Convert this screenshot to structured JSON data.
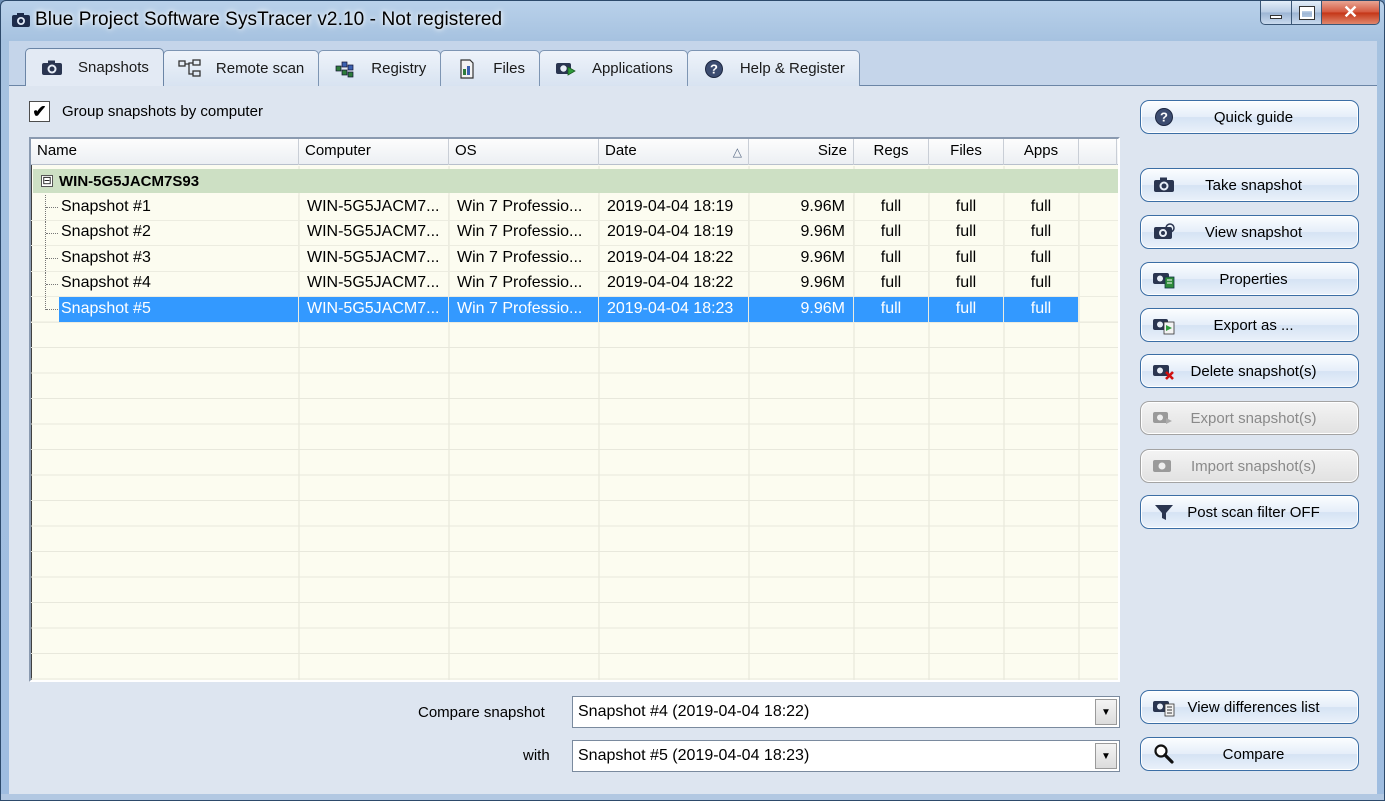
{
  "window": {
    "title": "Blue Project Software SysTracer v2.10 - Not registered"
  },
  "tabs": [
    {
      "label": "Snapshots",
      "icon": "camera-icon",
      "active": true
    },
    {
      "label": "Remote scan",
      "icon": "network-icon",
      "active": false
    },
    {
      "label": "Registry",
      "icon": "registry-icon",
      "active": false
    },
    {
      "label": "Files",
      "icon": "file-icon",
      "active": false
    },
    {
      "label": "Applications",
      "icon": "applications-icon",
      "active": false
    },
    {
      "label": "Help & Register",
      "icon": "help-icon",
      "active": false
    }
  ],
  "group_checkbox": {
    "label": "Group snapshots by computer",
    "checked": true,
    "mark": "✔"
  },
  "table": {
    "columns": [
      "Name",
      "Computer",
      "OS",
      "Date",
      "Size",
      "Regs",
      "Files",
      "Apps"
    ],
    "sort_indicator": "△",
    "group": {
      "name": "WIN-5G5JACM7S93",
      "expander": "⊟"
    },
    "rows": [
      {
        "name": "Snapshot #1",
        "computer": "WIN-5G5JACM7...",
        "os": "Win 7 Professio...",
        "date": "2019-04-04 18:19",
        "size": "9.96M",
        "regs": "full",
        "files": "full",
        "apps": "full",
        "selected": false
      },
      {
        "name": "Snapshot #2",
        "computer": "WIN-5G5JACM7...",
        "os": "Win 7 Professio...",
        "date": "2019-04-04 18:19",
        "size": "9.96M",
        "regs": "full",
        "files": "full",
        "apps": "full",
        "selected": false
      },
      {
        "name": "Snapshot #3",
        "computer": "WIN-5G5JACM7...",
        "os": "Win 7 Professio...",
        "date": "2019-04-04 18:22",
        "size": "9.96M",
        "regs": "full",
        "files": "full",
        "apps": "full",
        "selected": false
      },
      {
        "name": "Snapshot #4",
        "computer": "WIN-5G5JACM7...",
        "os": "Win 7 Professio...",
        "date": "2019-04-04 18:22",
        "size": "9.96M",
        "regs": "full",
        "files": "full",
        "apps": "full",
        "selected": false
      },
      {
        "name": "Snapshot #5",
        "computer": "WIN-5G5JACM7...",
        "os": "Win 7 Professio...",
        "date": "2019-04-04 18:23",
        "size": "9.96M",
        "regs": "full",
        "files": "full",
        "apps": "full",
        "selected": true
      }
    ]
  },
  "buttons": {
    "quick_guide": "Quick guide",
    "take_snapshot": "Take snapshot",
    "view_snapshot": "View snapshot",
    "properties": "Properties",
    "export_as": "Export as ...",
    "delete_snapshots": "Delete snapshot(s)",
    "export_snapshots": "Export snapshot(s)",
    "import_snapshots": "Import snapshot(s)",
    "post_scan_filter": "Post scan filter OFF",
    "view_differences": "View differences list",
    "compare": "Compare"
  },
  "compare": {
    "label": "Compare snapshot",
    "with_label": "with",
    "first_value": "Snapshot #4 (2019-04-04 18:22)",
    "second_value": "Snapshot #5 (2019-04-04 18:23)"
  },
  "colors": {
    "selection": "#3399ff",
    "group_row": "#cde0c4",
    "list_background": "#fcfcf0"
  }
}
